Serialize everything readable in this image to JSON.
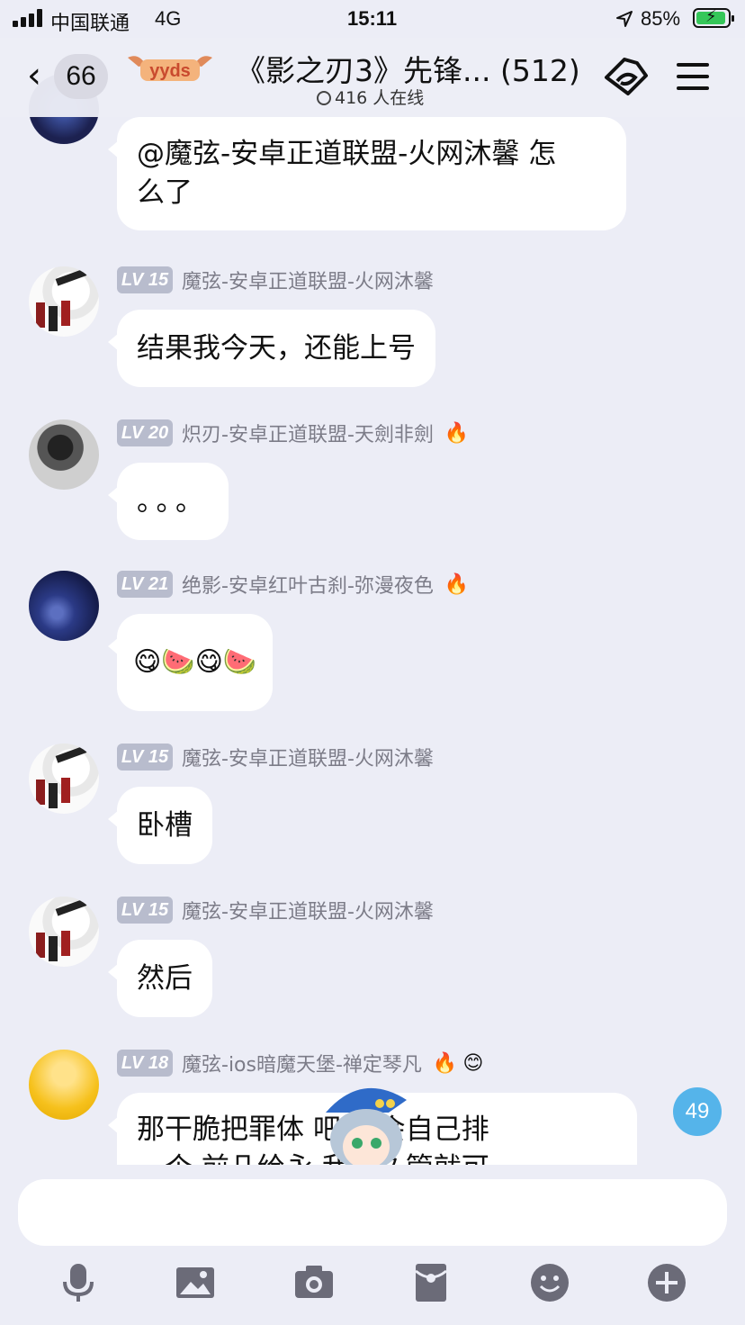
{
  "status_bar": {
    "carrier": "中国联通",
    "network": "4G",
    "time": "15:11",
    "battery": "85%"
  },
  "header": {
    "back_count": "66",
    "badge_text": "yyds",
    "title": "《影之刃3》先锋... (512)",
    "online": "416 人在线"
  },
  "messages": [
    {
      "avatar": "dark-space-avatar",
      "text": "@魔弦-安卓正道联盟-火网沐馨 怎\n么了"
    },
    {
      "avatar": "ink-sketch-avatar",
      "level": "LV 15",
      "nick": "魔弦-安卓正道联盟-火网沐馨",
      "text": "结果我今天，还能上号"
    },
    {
      "avatar": "grey-silhouette-avatar",
      "level": "LV 20",
      "nick": "炽刃-安卓正道联盟-天劍非劍",
      "fire": "🔥",
      "text": "。。。"
    },
    {
      "avatar": "night-sky-avatar",
      "level": "LV 21",
      "nick": "绝影-安卓红叶古刹-弥漫夜色",
      "fire": "🔥",
      "text": "😋🍉😋🍉"
    },
    {
      "avatar": "ink-sketch-avatar",
      "level": "LV 15",
      "nick": "魔弦-安卓正道联盟-火网沐馨",
      "text": "卧槽"
    },
    {
      "avatar": "ink-sketch-avatar",
      "level": "LV 15",
      "nick": "魔弦-安卓正道联盟-火网沐馨",
      "text": "然后"
    },
    {
      "avatar": "yellow-ball-avatar",
      "level": "LV 18",
      "nick": "魔弦-ios暗魔天堡-禅定琴凡",
      "fire": "🔥",
      "smile": "😊",
      "text": "那干脆把罪体    吧  帮会自己排\n一个 前几给永    我永久管就可"
    }
  ],
  "unread_count": "49",
  "toolbar": {
    "icons": [
      "microphone-icon",
      "image-icon",
      "camera-icon",
      "red-packet-icon",
      "emoji-icon",
      "plus-icon"
    ]
  }
}
